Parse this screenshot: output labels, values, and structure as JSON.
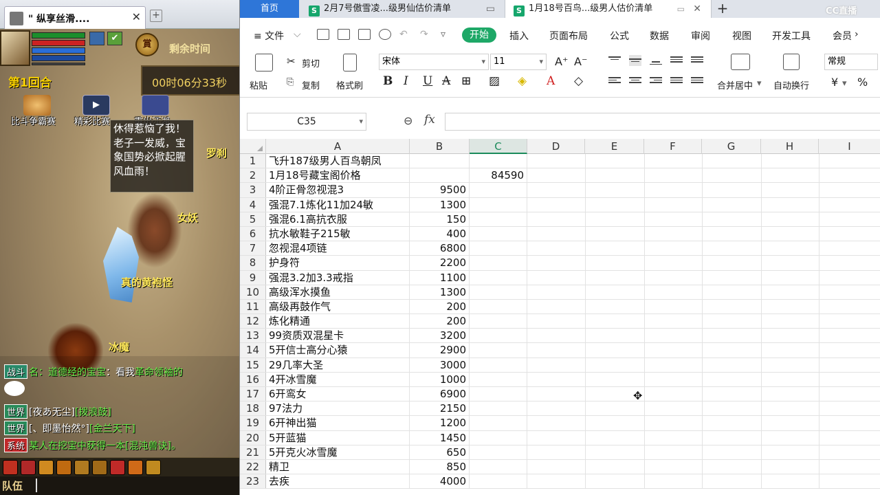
{
  "game": {
    "tab_title": "\" 纵享丝滑....",
    "timer_label": "剩余时间",
    "timer_value": "00时06分33秒",
    "round_label": "第1回合",
    "medal_text": "賞",
    "check_mark": "✔",
    "icons": [
      {
        "label": "比斗争霸赛"
      },
      {
        "label": "精彩比赛"
      },
      {
        "label": "重出江湖"
      }
    ],
    "bubble_text": "休得惹恼了我！老子一发威，宝象国势必掀起腥风血雨！",
    "names": [
      "罗刹",
      "女妖",
      "真的黄袍怪",
      "冰魔"
    ],
    "chat": [
      {
        "tag": "战斗",
        "prefix": "名：",
        "speaker": "道德经的宝宝",
        "text": "：看我",
        "highlight": "革命领袖的"
      },
      {
        "tag": "世界",
        "text": "[夜あ无尘]",
        "highlight": "[拨浪鼓]"
      },
      {
        "tag": "世界",
        "text": "[、即墨怡然°]",
        "highlight": "[金兰天下]"
      },
      {
        "tag": "系统",
        "text": "某人在挖宝中获得一本",
        "highlight": "[混沌兽诀]。"
      }
    ],
    "team_label": "队伍"
  },
  "app": {
    "home_tab": "首页",
    "doc_tabs": [
      {
        "icon": "S",
        "title": "2月7号傲雪凌...级男仙估价清单"
      },
      {
        "icon": "S",
        "title": "1月18号百鸟...级男人估价清单"
      }
    ],
    "plus": "+",
    "cc_logo": "CC直播",
    "menu": {
      "file": "≡ 文件",
      "file_dd": "⌵",
      "start": "开始",
      "insert": "插入",
      "layout": "页面布局",
      "formula": "公式",
      "data": "数据",
      "review": "审阅",
      "view": "视图",
      "dev": "开发工具",
      "member": "会员",
      "more": "›"
    },
    "ribbon": {
      "paste": "粘贴",
      "cut": "剪切",
      "copy": "复制",
      "format_painter": "格式刷",
      "font_name": "宋体",
      "font_size": "11",
      "grow": "A⁺",
      "shrink": "A⁻",
      "bold": "B",
      "italic": "I",
      "underline": "U",
      "strike": "A",
      "merge": "合并居中",
      "wrap": "自动换行",
      "num_format": "常规",
      "currency": "¥",
      "percent": "%",
      "dd": "▾"
    },
    "namebox": "C35",
    "fx": "fx",
    "zoom_glyph": "⊖",
    "columns": [
      "A",
      "B",
      "C",
      "D",
      "E",
      "F",
      "G",
      "H",
      "I"
    ],
    "selected_column": "C",
    "rows": [
      {
        "n": "1",
        "a": "飞升187级男人百鸟朝凤",
        "b": "",
        "c": ""
      },
      {
        "n": "2",
        "a": "1月18号藏宝阁价格",
        "b": "",
        "c": "84590"
      },
      {
        "n": "3",
        "a": "4阶正骨忽视混3",
        "b": "9500",
        "c": ""
      },
      {
        "n": "4",
        "a": "强混7.1炼化11加24敏",
        "b": "1300",
        "c": ""
      },
      {
        "n": "5",
        "a": "强混6.1高抗衣服",
        "b": "150",
        "c": ""
      },
      {
        "n": "6",
        "a": "抗水敏鞋子215敏",
        "b": "400",
        "c": ""
      },
      {
        "n": "7",
        "a": "忽视混4项链",
        "b": "6800",
        "c": ""
      },
      {
        "n": "8",
        "a": "护身符",
        "b": "2200",
        "c": ""
      },
      {
        "n": "9",
        "a": "强混3.2加3.3戒指",
        "b": "1100",
        "c": ""
      },
      {
        "n": "10",
        "a": "高级浑水摸鱼",
        "b": "1300",
        "c": ""
      },
      {
        "n": "11",
        "a": "高级再鼓作气",
        "b": "200",
        "c": ""
      },
      {
        "n": "12",
        "a": "炼化精通",
        "b": "200",
        "c": ""
      },
      {
        "n": "13",
        "a": "99资质双混星卡",
        "b": "3200",
        "c": ""
      },
      {
        "n": "14",
        "a": "5开信士高分心猿",
        "b": "2900",
        "c": ""
      },
      {
        "n": "15",
        "a": "29几率大圣",
        "b": "3000",
        "c": ""
      },
      {
        "n": "16",
        "a": "4开冰雪魔",
        "b": "1000",
        "c": ""
      },
      {
        "n": "17",
        "a": "6开鸾女",
        "b": "6900",
        "c": ""
      },
      {
        "n": "18",
        "a": "97法力",
        "b": "2150",
        "c": ""
      },
      {
        "n": "19",
        "a": "6开神出猫",
        "b": "1200",
        "c": ""
      },
      {
        "n": "20",
        "a": "5开蓝猫",
        "b": "1450",
        "c": ""
      },
      {
        "n": "21",
        "a": "5开克火冰雪魔",
        "b": "650",
        "c": ""
      },
      {
        "n": "22",
        "a": "精卫",
        "b": "850",
        "c": ""
      },
      {
        "n": "23",
        "a": "去疾",
        "b": "4000",
        "c": ""
      }
    ],
    "cursor_glyph": "✥"
  }
}
